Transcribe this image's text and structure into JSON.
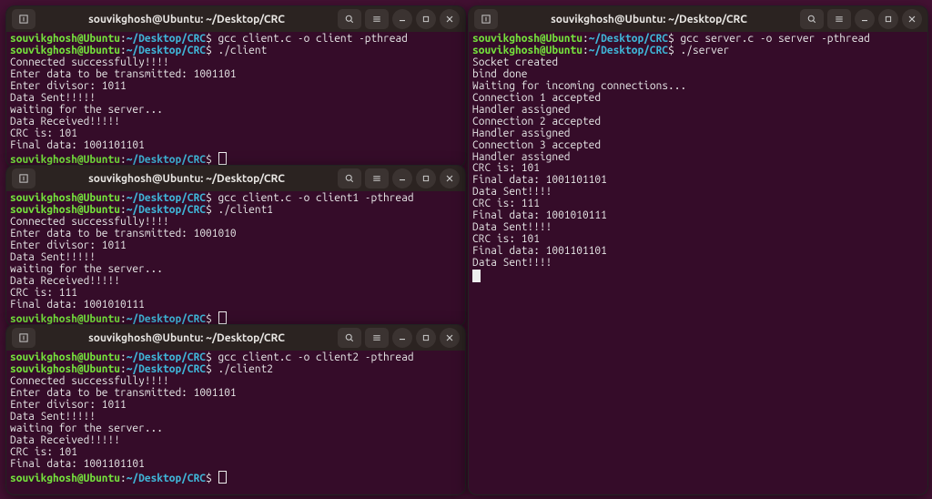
{
  "user": "souvikghosh@Ubuntu",
  "sep": ":",
  "path": "~/Desktop/CRC",
  "dollar": "$ ",
  "titles": {
    "w1": "souvikghosh@Ubuntu: ~/Desktop/CRC",
    "w2": "souvikghosh@Ubuntu: ~/Desktop/CRC",
    "w3": "souvikghosh@Ubuntu: ~/Desktop/CRC",
    "w4": "souvikghosh@Ubuntu: ~/Desktop/CRC"
  },
  "w1": {
    "cmd1": "gcc client.c -o client -pthread",
    "cmd2": "./client",
    "out": "Connected successfully!!!!\nEnter data to be transmitted: 1001101\nEnter divisor: 1011\nData Sent!!!!!\nwaiting for the server...\nData Received!!!!!\nCRC is: 101\nFinal data: 1001101101"
  },
  "w2": {
    "cmd1": "gcc client.c -o client1 -pthread",
    "cmd2": "./client1",
    "out": "Connected successfully!!!!\nEnter data to be transmitted: 1001010\nEnter divisor: 1011\nData Sent!!!!!\nwaiting for the server...\nData Received!!!!!\nCRC is: 111\nFinal data: 1001010111"
  },
  "w3": {
    "cmd1": "gcc client.c -o client2 -pthread",
    "cmd2": "./client2",
    "out": "Connected successfully!!!!\nEnter data to be transmitted: 1001101\nEnter divisor: 1011\nData Sent!!!!!\nwaiting for the server...\nData Received!!!!!\nCRC is: 101\nFinal data: 1001101101"
  },
  "w4": {
    "cmd1": "gcc server.c -o server -pthread",
    "cmd2": "./server",
    "out": "Socket created\nbind done\nWaiting for incoming connections...\nConnection 1 accepted\nHandler assigned\nConnection 2 accepted\nHandler assigned\nConnection 3 accepted\nHandler assigned\nCRC is: 101\nFinal data: 1001101101\nData Sent!!!!\nCRC is: 111\nFinal data: 1001010111\nData Sent!!!!\nCRC is: 101\nFinal data: 1001101101\nData Sent!!!!"
  }
}
